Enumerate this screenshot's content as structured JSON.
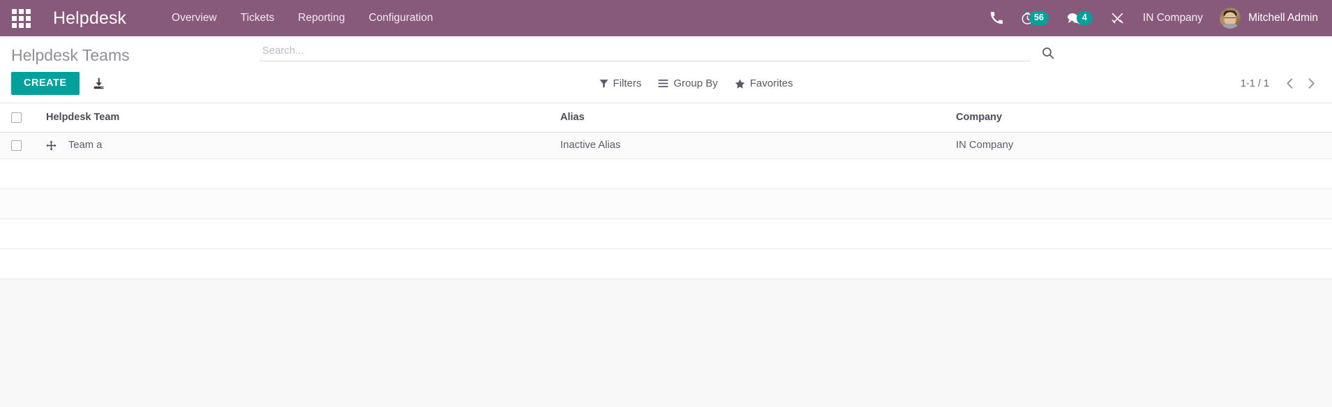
{
  "navbar": {
    "apps_icon": "apps-grid-icon",
    "brand": "Helpdesk",
    "menu": [
      {
        "label": "Overview",
        "name": "nav-overview"
      },
      {
        "label": "Tickets",
        "name": "nav-tickets"
      },
      {
        "label": "Reporting",
        "name": "nav-reporting"
      },
      {
        "label": "Configuration",
        "name": "nav-configuration"
      }
    ],
    "sysicons": {
      "phone": "phone-icon",
      "timer": "timesheet-timer-icon",
      "timer_badge": "56",
      "messages": "messages-icon",
      "messages_badge": "4",
      "activities": "activities-tools-icon"
    },
    "company": "IN Company",
    "username": "Mitchell Admin",
    "bg_color": "#875A7B",
    "badge_color": "#00A09D"
  },
  "control_panel": {
    "page_title": "Helpdesk Teams",
    "search": {
      "placeholder": "Search...",
      "value": "",
      "search_icon": "search-icon"
    },
    "create_label": "CREATE",
    "create_color": "#00A09D",
    "import_icon": "import-upload-icon",
    "filters": [
      {
        "label": "Filters",
        "icon": "filter-funnel-icon",
        "name": "filters-dropdown"
      },
      {
        "label": "Group By",
        "icon": "group-by-bars-icon",
        "name": "group-by-dropdown"
      },
      {
        "label": "Favorites",
        "icon": "favorites-star-icon",
        "name": "favorites-dropdown"
      }
    ],
    "pager": {
      "count": "1-1 / 1",
      "prev_icon": "chevron-left-icon",
      "next_icon": "chevron-right-icon"
    }
  },
  "list": {
    "columns": [
      {
        "label": "Helpdesk Team"
      },
      {
        "label": "Alias"
      },
      {
        "label": "Company"
      }
    ],
    "rows": [
      {
        "name": "Team a",
        "alias": "Inactive Alias",
        "company": "IN Company",
        "handle_icon": "drag-handle-icon"
      }
    ],
    "filler_row_count": 4
  }
}
